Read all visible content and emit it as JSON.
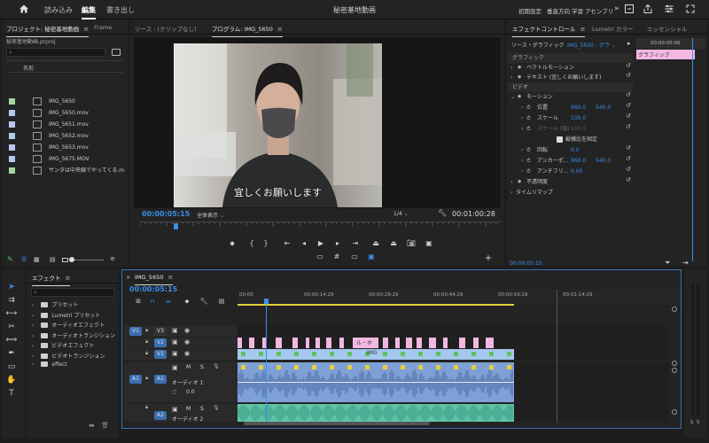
{
  "topbar": {
    "nav": [
      "読み込み",
      "編集",
      "書き出し"
    ],
    "title": "秘密基地動画",
    "workspaces": [
      "初期設定",
      "垂直方向",
      "学習",
      "アセンブリ"
    ],
    "overflow": "»"
  },
  "project": {
    "tab": "プロジェクト: 秘密基地動画",
    "tab2": "Frame",
    "file": "秘密基地動画.prproj",
    "column_header": "名前",
    "items": [
      {
        "name": "IMG_5650",
        "color": "#a3d9a0"
      },
      {
        "name": "IMG_5650.mov",
        "color": "#b7c9f0"
      },
      {
        "name": "IMG_5651.mov",
        "color": "#b7c9f0"
      },
      {
        "name": "IMG_5652.mov",
        "color": "#b7c9f0"
      },
      {
        "name": "IMG_5653.mov",
        "color": "#b7c9f0"
      },
      {
        "name": "IMG_5675.MOV",
        "color": "#b7c9f0"
      },
      {
        "name": "サンタは中央線でやってくる.m",
        "color": "#a3d9a0"
      }
    ]
  },
  "source": {
    "tab": "ソース : (クリップなし)"
  },
  "program": {
    "tab": "プログラム: IMG_5650",
    "timecode": "00:00:05:15",
    "zoom": "全体表示",
    "quality": "1/4",
    "duration": "00:01:00:28",
    "subtitle": "宜しくお願いします"
  },
  "effect_controls": {
    "tab": "エフェクトコントロール",
    "tab2": "Lumetri カラー",
    "tab3": "エッセンシャル",
    "source_label": "ソース・グラフィック",
    "clip_label": "IMG_5650 - グラ",
    "mini_time": "00:00:05:00",
    "clip_name": "グラフィック",
    "section_graphic": "グラフィック",
    "vector_motion": "ベクトルモーション",
    "text_layer": "テキスト (宜しくお願いします)",
    "section_video": "ビデオ",
    "motion": "モーション",
    "position_label": "位置",
    "position_x": "960.0",
    "position_y": "540.0",
    "scale_label": "スケール",
    "scale_value": "100.0",
    "scale_w_label": "スケール (幅)",
    "scale_w_value": "100.0",
    "uniform_scale": "縦横比を固定",
    "rotation_label": "回転",
    "rotation_value": "0.0",
    "anchor_label": "アンカーポ...",
    "anchor_x": "960.0",
    "anchor_y": "540.0",
    "antiflicker_label": "アンチフリ...",
    "antiflicker_value": "0.00",
    "opacity": "不透明度",
    "time_remap": "タイムリマップ",
    "footer_time": "00:00:05:15"
  },
  "effects": {
    "tab": "エフェクト",
    "items": [
      "プリセット",
      "Lumetri プリセット",
      "オーディオエフェクト",
      "オーディオトランジション",
      "ビデオエフェクト",
      "ビデオトランジション",
      "effect"
    ]
  },
  "timeline": {
    "tab": "IMG_5650",
    "timecode": "00:00:05:15",
    "ruler": [
      "00:00",
      "00:00:14:29",
      "00:00:29:29",
      "00:00:44:29",
      "00:00:59:29",
      "00:01:14:29"
    ],
    "tracks_video": [
      "V3",
      "V2",
      "V1"
    ],
    "tracks_audio": [
      "A1",
      "A2"
    ],
    "v1_source": "V1",
    "a1_source": "A1",
    "a1_name": "オーディオ 1",
    "a2_name": "オーディオ 2",
    "a1_level": "0.0",
    "m": "M",
    "s": "S",
    "clip_label_v2": "ル・ホ",
    "clip_label_v1": "IMG",
    "audio_meter": [
      "S",
      "S"
    ]
  },
  "colors": {
    "accent": "#3b8eea",
    "video_clip": "#a4c8ef",
    "graphic_clip": "#f2b8e2",
    "audio_clip_a1": "#7ea0d6",
    "audio_clip_a2": "#5fc3a8",
    "panel": "#232323",
    "background": "#1d1d1d"
  }
}
